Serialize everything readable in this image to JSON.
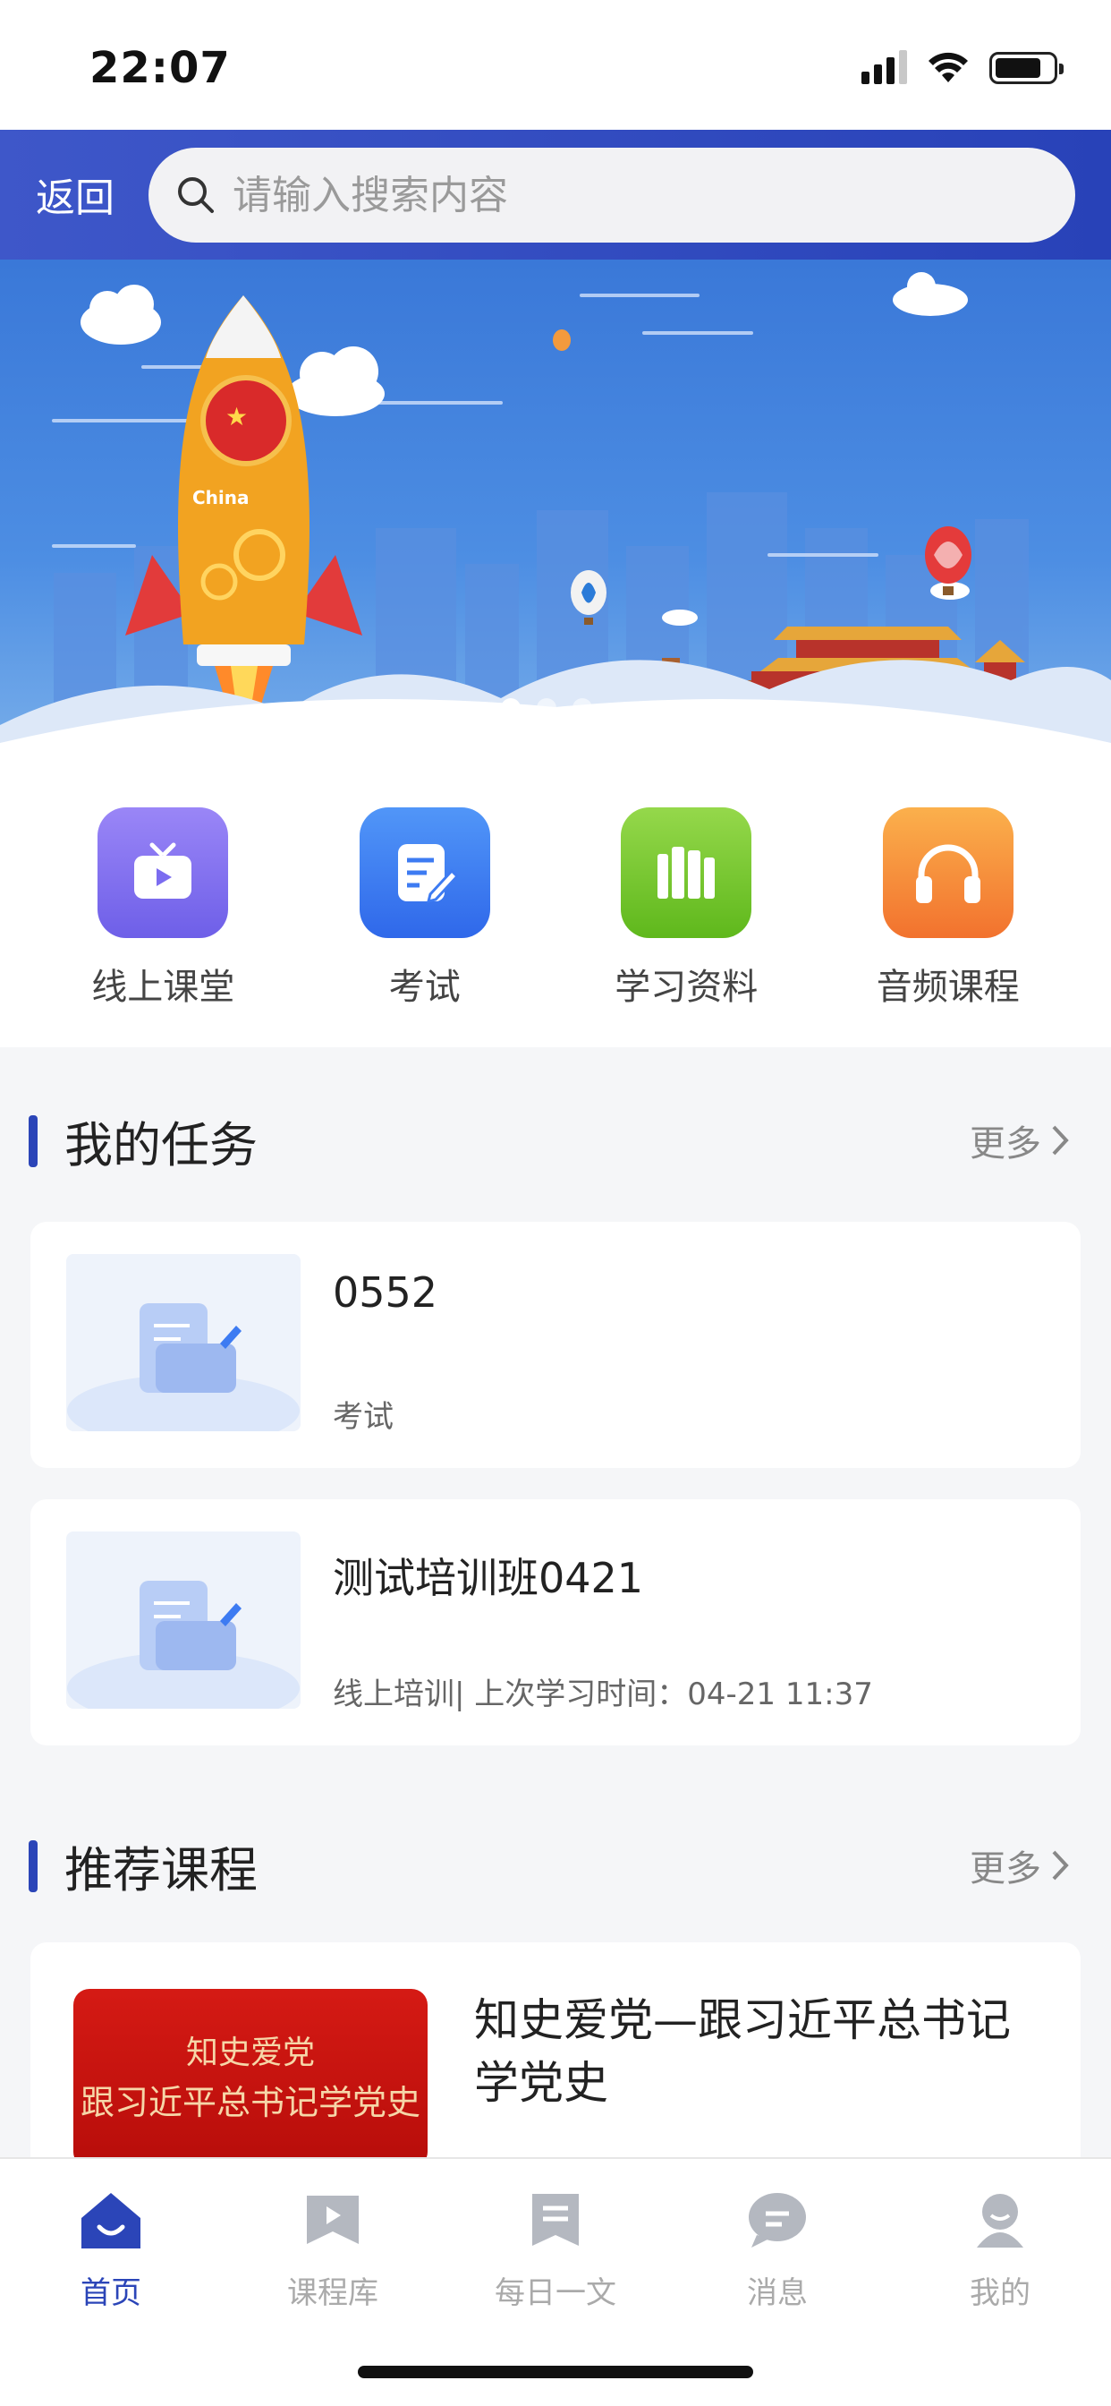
{
  "status_bar": {
    "time": "22:07"
  },
  "header": {
    "back_label": "返回",
    "search_placeholder": "请输入搜索内容"
  },
  "banner": {
    "rocket_text": "China",
    "slides": 3,
    "active_slide": 1
  },
  "quick_entries": [
    {
      "label": "线上课堂",
      "icon": "tv-icon",
      "color": "#7b6cf0"
    },
    {
      "label": "考试",
      "icon": "exam-edit-icon",
      "color": "#3d7bf2"
    },
    {
      "label": "学习资料",
      "icon": "books-icon",
      "color": "#74c72a"
    },
    {
      "label": "音频课程",
      "icon": "headphones-icon",
      "color": "#f5893a"
    }
  ],
  "tasks_section": {
    "title": "我的任务",
    "more_label": "更多",
    "items": [
      {
        "title": "0552",
        "subtitle": "考试"
      },
      {
        "title": "测试培训班0421",
        "subtitle": "线上培训| 上次学习时间：04-21 11:37"
      }
    ]
  },
  "recommend_section": {
    "title": "推荐课程",
    "more_label": "更多",
    "course": {
      "image_line1": "知史爱党",
      "image_line2": "跟习近平总书记学党史",
      "title": "知史爱党—跟习近平总书记学党史"
    }
  },
  "tabbar": {
    "items": [
      {
        "label": "首页",
        "icon": "home-icon",
        "active": true
      },
      {
        "label": "课程库",
        "icon": "course-library-icon",
        "active": false
      },
      {
        "label": "每日一文",
        "icon": "daily-article-icon",
        "active": false
      },
      {
        "label": "消息",
        "icon": "message-icon",
        "active": false
      },
      {
        "label": "我的",
        "icon": "profile-icon",
        "active": false
      }
    ]
  },
  "colors": {
    "accent": "#2b45b8",
    "header_gradient_start": "#3e57c9",
    "header_gradient_end": "#2842b8"
  }
}
